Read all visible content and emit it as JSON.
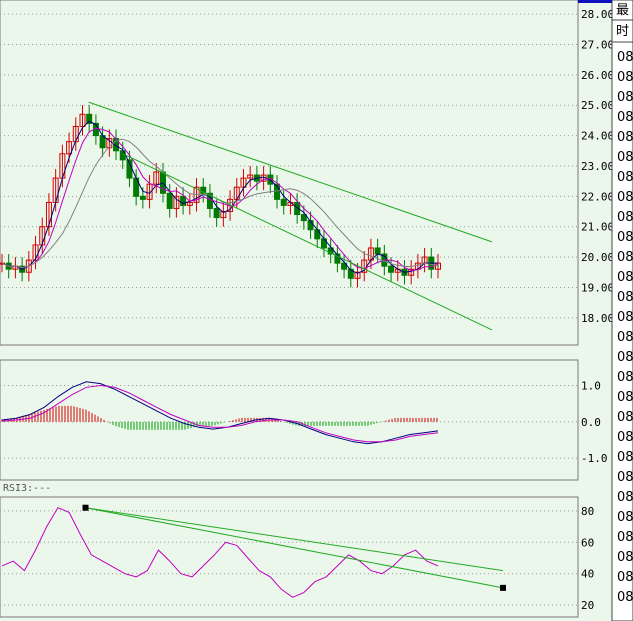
{
  "colors": {
    "background": "#ecf7ec",
    "up_candle": "#d40000",
    "down_candle": "#007a00",
    "ma_short": "#000080",
    "ma_mid": "#c000c0",
    "ma_long": "#808080",
    "channel": "#22aa22",
    "macd_line": "#000080",
    "signal_line": "#c000c0",
    "hist_pos": "#d40000",
    "hist_neg": "#00a000",
    "rsi_line": "#c000c0",
    "trend_line": "#22aa22"
  },
  "side_panel": {
    "header_top": "最",
    "header_sub": "时",
    "row_prefix": "08",
    "row_count": 28
  },
  "chart_data": [
    {
      "type": "candlestick",
      "title": "",
      "ylim": [
        17.5,
        28.2
      ],
      "yticks": [
        "18.00",
        "19.00",
        "20.00",
        "21.00",
        "22.00",
        "23.00",
        "24.00",
        "25.00",
        "26.00",
        "27.00",
        "28.00"
      ],
      "close_path": [
        19.8,
        19.6,
        19.7,
        19.5,
        19.9,
        20.4,
        21.0,
        21.8,
        22.6,
        23.4,
        23.8,
        24.3,
        24.7,
        24.4,
        24.0,
        23.6,
        23.9,
        23.5,
        23.2,
        22.6,
        22.0,
        21.9,
        22.4,
        22.8,
        22.1,
        21.6,
        22.0,
        21.7,
        21.8,
        22.3,
        22.1,
        21.6,
        21.3,
        21.5,
        21.9,
        22.3,
        22.6,
        22.7,
        22.5,
        22.7,
        22.4,
        21.9,
        21.7,
        21.8,
        21.4,
        21.2,
        20.9,
        20.6,
        20.3,
        20.1,
        19.8,
        19.6,
        19.3,
        19.5,
        19.9,
        20.3,
        20.1,
        19.7,
        19.5,
        19.6,
        19.4,
        19.6,
        19.8,
        20.0,
        19.6,
        19.8
      ],
      "channel_upper": {
        "x_start": 0.18,
        "y_start": 25.1,
        "x_end": 1.0,
        "y_end": 20.5
      },
      "channel_lower": {
        "x_start": 0.25,
        "y_start": 23.4,
        "x_end": 1.0,
        "y_end": 17.6
      }
    },
    {
      "type": "line",
      "title": "",
      "ylim": [
        -1.6,
        1.7
      ],
      "yticks": [
        "1.0",
        "0.0",
        "-1.0"
      ],
      "macd": [
        0.05,
        0.1,
        0.2,
        0.4,
        0.7,
        0.95,
        1.1,
        1.05,
        0.9,
        0.7,
        0.5,
        0.3,
        0.1,
        -0.05,
        -0.15,
        -0.2,
        -0.15,
        -0.05,
        0.05,
        0.1,
        0.05,
        -0.05,
        -0.2,
        -0.35,
        -0.45,
        -0.55,
        -0.6,
        -0.55,
        -0.45,
        -0.35,
        -0.3,
        -0.25
      ],
      "signal": [
        0.02,
        0.05,
        0.1,
        0.25,
        0.5,
        0.75,
        0.95,
        1.0,
        0.95,
        0.8,
        0.6,
        0.4,
        0.2,
        0.05,
        -0.1,
        -0.15,
        -0.15,
        -0.1,
        0.0,
        0.05,
        0.05,
        0.0,
        -0.15,
        -0.3,
        -0.4,
        -0.5,
        -0.55,
        -0.55,
        -0.5,
        -0.4,
        -0.35,
        -0.3
      ]
    },
    {
      "type": "line",
      "title": "RSI3:---",
      "ylim": [
        15,
        85
      ],
      "yticks": [
        "80",
        "60",
        "40",
        "20"
      ],
      "rsi": [
        45,
        48,
        42,
        55,
        70,
        82,
        79,
        65,
        52,
        48,
        44,
        40,
        38,
        42,
        55,
        48,
        40,
        38,
        45,
        52,
        60,
        58,
        50,
        42,
        38,
        30,
        25,
        28,
        35,
        38,
        45,
        52,
        48,
        42,
        40,
        45,
        52,
        55,
        48,
        45
      ],
      "trend_upper": {
        "x1": 0.17,
        "y1": 82,
        "x2": 1.0,
        "y2": 42
      },
      "trend_lower": {
        "x1": 0.17,
        "y1": 82,
        "x2": 1.0,
        "y2": 31
      }
    }
  ]
}
